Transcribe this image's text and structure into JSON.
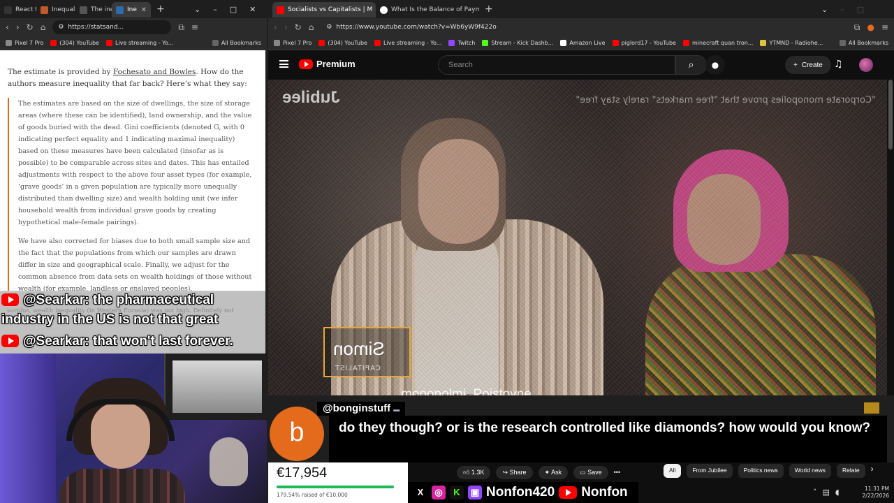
{
  "left_browser": {
    "tabs": [
      {
        "label": "React t",
        "color": "#ff7f50"
      },
      {
        "label": "Inequal",
        "color": "#c05a2a"
      },
      {
        "label": "The ine",
        "color": "#444444"
      },
      {
        "label": "Ine",
        "color": "#2a6db0",
        "active": true
      }
    ],
    "url": "https://statsand...",
    "bookmarks": [
      "Pixel 7 Pro",
      "(304) YouTube",
      "Live streaming - Yo...",
      "All Bookmarks"
    ]
  },
  "article": {
    "lead_before": "The estimate is provided by ",
    "lead_link": "Fochesato and Bowles",
    "lead_after": ". How do the authors measure inequality that far back? Here’s what they say:",
    "quote_p1": "The estimates are based on the size of dwellings, the size of storage areas (where these can be identified), land ownership, and the value of goods buried with the dead. Gini coefficients (denoted G, with 0 indicating perfect equality and 1 indicating maximal inequality) based on these measures have been calculated (insofar as is possible) to be comparable across sites and dates. This has entailed adjustments with respect to the above four asset types (for example, ‘grave goods’ in a given population are typically more unequally distributed than dwelling size) and wealth holding unit (we infer household wealth from individual grave goods by creating hypothetical male-female pairings).",
    "quote_p2": "We have also corrected for biases due to both small sample size and the fact that the populations from which our samples are drawn differ in size and geographical scale. Finally, we adjust for the common absence from data sets on wealth holdings of those without wealth (for example, landless or enslaved peoples).",
    "faded": "surplus, wealth inequality (in Western Eurasia) was not high. Definitely not"
  },
  "stream_chat": [
    {
      "user": "@Searkar:",
      "text_line1": " the pharmaceutical",
      "text_line2": "industry in the US is not that great"
    },
    {
      "user": "@Searkar:",
      "text_line1": " that won't last forever."
    }
  ],
  "right_browser": {
    "tabs": [
      {
        "label": "Socialists vs Capitalists | M",
        "color": "#ff0000",
        "active": true
      },
      {
        "label": "What Is the Balance of Paymen",
        "color": "#ffffff"
      }
    ],
    "url": "https://www.youtube.com/watch?v=Wb6yW9f422o",
    "bookmarks": [
      "Pixel 7 Pro",
      "(304) YouTube",
      "Live streaming - Yo...",
      "Twitch",
      "Stream - Kick Dashb...",
      "Amazon Live",
      "piglord17 - YouTube",
      "minecraft quan tron...",
      "YTMND - Radiohe...",
      "All Bookmarks"
    ]
  },
  "youtube": {
    "logo": "Premium",
    "search_placeholder": "Search",
    "create_label": "Create",
    "video_brand": "Jubilee",
    "video_caption": "\"Corporate monopolies prove that \"free markets\" rarely stay free\"",
    "lower_third_name": "Simon",
    "lower_third_role": "CAPITALIST",
    "video_sub": "monopolmi.  Poistovne",
    "likes": "1.3K",
    "share": "Share",
    "ask": "Ask",
    "save": "Save",
    "chips": [
      "All",
      "From Jubilee",
      "Politics news",
      "World news",
      "Relate"
    ]
  },
  "featured_chat": {
    "initial": "b",
    "user": "@bonginstuff",
    "message": "do they though? or is the research controlled like diamonds? how would you know?",
    "accent": "#e46a1c"
  },
  "donation": {
    "amount": "€17,954",
    "raised": "179.54% raised of €10,000",
    "progress_fraction": 1.0
  },
  "socials": {
    "handle1": "Nonfon420",
    "handle2": "Nonfon",
    "icons": [
      "x-icon",
      "instagram-icon",
      "kick-icon",
      "twitch-icon",
      "youtube-icon"
    ]
  },
  "taskbar": {
    "time": "11:31 PM",
    "date": "2/22/2026"
  },
  "window_controls": {
    "min": "–",
    "max": "□",
    "close": "✕"
  }
}
